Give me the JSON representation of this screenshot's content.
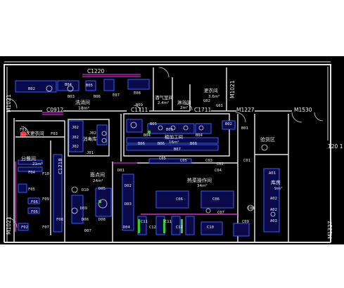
{
  "colors": {
    "background": "#000000",
    "wall": "#e6e6e6",
    "wall_inner": "#c8c8c8",
    "equipment": "#3a5cff",
    "equipment_fill": "#0a0a4a",
    "text": "#f0f0f0",
    "accent_magenta": "#ff33ff",
    "accent_green": "#33cc33",
    "accent_red": "#ff3333",
    "room_border": "#e0e0e0"
  },
  "drawing": {
    "openings": {
      "c1220": "C1220",
      "c0912": "C0912",
      "c1711a": "C1711",
      "c1711b": "C1711",
      "m1227": "M1227",
      "m1530": "M1530",
      "m1021_left_top": "M1021",
      "m1021_left_bottom": "M1021",
      "m1021_top": "M1021",
      "m1327": "M1327",
      "side_1201": "120 1"
    },
    "rooms": {
      "wash_room": {
        "name": "洗消间",
        "area": "18m²"
      },
      "dressing_room": {
        "name": "更衣间",
        "area": "3.6m²"
      },
      "secondary_dressing": {
        "name": "二次更衣间",
        "area": ""
      },
      "sterilize_room": {
        "name": "消毒库",
        "area": ""
      },
      "serving_room": {
        "name": "分餐间",
        "area": "21m²"
      },
      "pastry_room": {
        "name": "面点间",
        "area": "24m²"
      },
      "rough_room": {
        "name": "粗加工间",
        "area": "16m²"
      },
      "hot_kitchen": {
        "name": "热菜操作间",
        "area": "34m²"
      },
      "storeroom": {
        "name": "库房",
        "area": "9m²"
      },
      "inspection": {
        "name": "验货区",
        "area": ""
      },
      "wine_room": {
        "name": "酒气室间",
        "area": "2.4m²"
      },
      "shower_room": {
        "name": "淋浴间",
        "area": "2m²"
      }
    },
    "equipment": {
      "b02": "B02",
      "b03": "B03",
      "b04": "B04",
      "b05": "B05",
      "b06": "B06",
      "e07": "E07",
      "e08": "E08",
      "b09": "B09",
      "g01": "G01",
      "g02": "G02",
      "b03b": "B03",
      "b04b": "B04",
      "b05b": "B05",
      "b06b": "B06",
      "b07": "B07",
      "b08": "B08",
      "b06c": "B06",
      "b02b": "B02",
      "b01": "B01",
      "f01": "F01",
      "f03": "F03",
      "f04": "F04",
      "f05": "F05",
      "f06": "F06",
      "f07": "F07",
      "f08": "F08",
      "f09": "F09",
      "f10": "F10",
      "f02": "F02",
      "j01": "J01",
      "j02a": "J02",
      "j02b": "J02",
      "j02c": "J02",
      "j02d": "J02",
      "d01": "D01",
      "d02": "D02",
      "d03": "D03",
      "d04": "D04",
      "d05": "D05",
      "d06": "D06",
      "d07": "D07",
      "d08": "D08",
      "d09": "D09",
      "d10": "D10",
      "c01": "C01",
      "c02": "C02",
      "c03": "C03",
      "c04": "C04",
      "c05a": "C05",
      "c05b": "C05",
      "c06a": "C06",
      "c06b": "C06",
      "c07": "C07",
      "c08": "C08",
      "c09": "C09",
      "c10": "C10",
      "c11a": "C11",
      "c11b": "C11",
      "c12a": "C12",
      "c12b": "C12",
      "a01": "A01",
      "a02a": "A02",
      "a02b": "A02",
      "a03": "A03"
    }
  }
}
